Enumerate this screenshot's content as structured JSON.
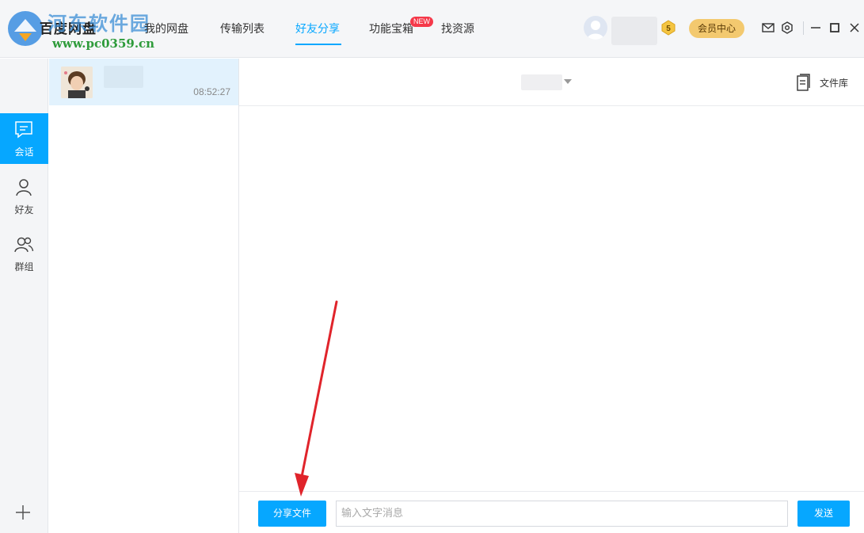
{
  "app": {
    "title": "百度网盘",
    "watermark_title": "河东软件园",
    "watermark_url": "www.pc0359.cn"
  },
  "nav": {
    "tabs": [
      {
        "label": "我的网盘",
        "active": false
      },
      {
        "label": "传输列表",
        "active": false
      },
      {
        "label": "好友分享",
        "active": true
      },
      {
        "label": "功能宝箱",
        "active": false,
        "badge": "NEW"
      },
      {
        "label": "找资源",
        "active": false
      }
    ]
  },
  "user": {
    "level": "5",
    "vip_button": "会员中心"
  },
  "rail": {
    "items": [
      {
        "label": "会话",
        "icon": "chat-icon",
        "active": true
      },
      {
        "label": "好友",
        "icon": "person-icon",
        "active": false
      },
      {
        "label": "群组",
        "icon": "group-icon",
        "active": false
      }
    ],
    "add_icon": "plus-icon"
  },
  "conversations": [
    {
      "time": "08:52:27",
      "selected": true
    }
  ],
  "chat": {
    "library_label": "文件库",
    "share_button": "分享文件",
    "input_placeholder": "输入文字消息",
    "input_value": "",
    "send_button": "发送"
  },
  "colors": {
    "accent": "#06a7ff",
    "vip": "#f3c96f",
    "new_badge": "#f5394a",
    "selected_row": "#e2f2fd",
    "arrow": "#e0242b"
  }
}
